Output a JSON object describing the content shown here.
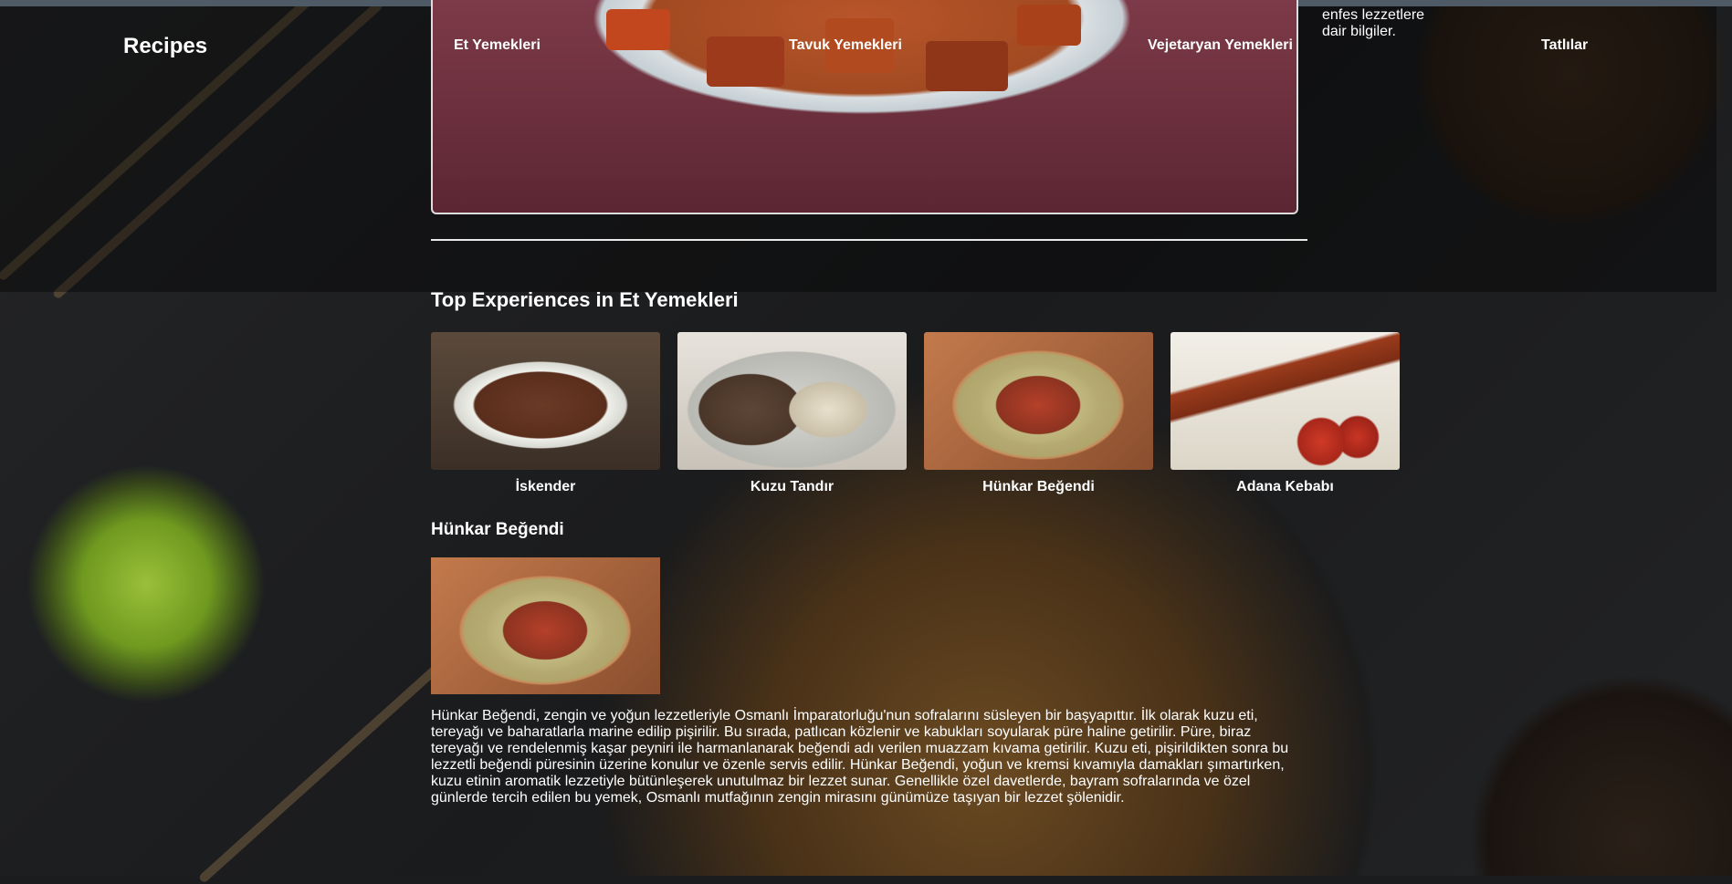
{
  "header": {
    "logo": "Recipes",
    "nav": [
      {
        "label": "Et Yemekleri"
      },
      {
        "label": "Tavuk Yemekleri"
      },
      {
        "label": "Vejetaryan Yemekleri"
      },
      {
        "label": "Tatlılar"
      }
    ],
    "side_text": "enfes lezzetlere dair bilgiler."
  },
  "top_section": {
    "title": "Top Experiences in Et Yemekleri",
    "cards": [
      {
        "name": "İskender"
      },
      {
        "name": "Kuzu Tandır"
      },
      {
        "name": "Hünkar Beğendi"
      },
      {
        "name": "Adana Kebabı"
      }
    ]
  },
  "detail": {
    "title": "Hünkar Beğendi",
    "description": "Hünkar Beğendi, zengin ve yoğun lezzetleriyle Osmanlı İmparatorluğu'nun sofralarını süsleyen bir başyapıttır. İlk olarak kuzu eti, tereyağı ve baharatlarla marine edilip pişirilir. Bu sırada, patlıcan közlenir ve kabukları soyularak püre haline getirilir. Püre, biraz tereyağı ve rendelenmiş kaşar peyniri ile harmanlanarak beğendi adı verilen muazzam kıvama getirilir. Kuzu eti, pişirildikten sonra bu lezzetli beğendi püresinin üzerine konulur ve özenle servis edilir. Hünkar Beğendi, yoğun ve kremsi kıvamıyla damakları şımartırken, kuzu etinin aromatik lezzetiyle bütünleşerek unutulmaz bir lezzet sunar. Genellikle özel davetlerde, bayram sofralarında ve özel günlerde tercih edilen bu yemek, Osmanlı mutfağının zengin mirasını günümüze taşıyan bir lezzet şölenidir."
  }
}
